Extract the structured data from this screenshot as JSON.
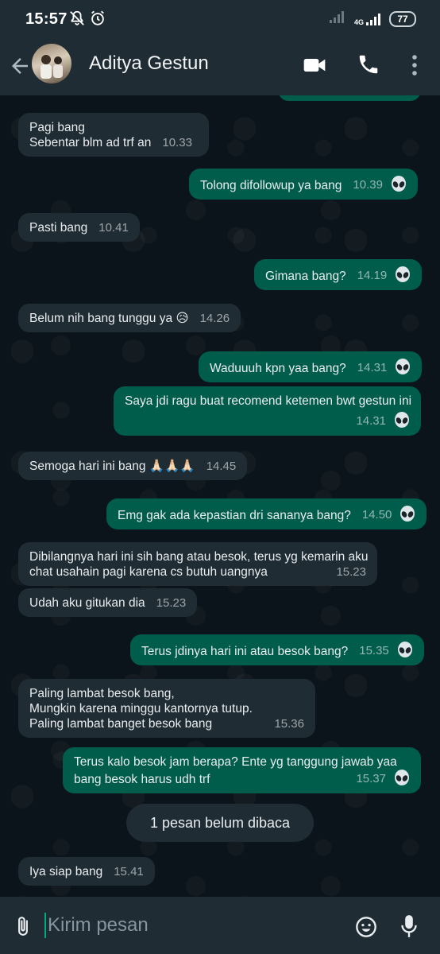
{
  "status_bar": {
    "time": "15:57",
    "network": "4G",
    "battery": "77"
  },
  "header": {
    "contact_name": "Aditya Gestun",
    "back_icon": "arrow-left-icon",
    "video_icon": "video-camera-icon",
    "call_icon": "phone-icon",
    "menu_icon": "more-vert-icon"
  },
  "messages": [
    {
      "direction": "in",
      "lines": [
        "Pagi bang",
        "Sebentar blm ad trf an"
      ],
      "time": "10.33"
    },
    {
      "direction": "out",
      "lines": [
        "Tolong difollowup ya bang"
      ],
      "time": "10.39"
    },
    {
      "direction": "in",
      "lines": [
        "Pasti bang"
      ],
      "time": "10.41"
    },
    {
      "direction": "out",
      "lines": [
        "Gimana bang?"
      ],
      "time": "14.19"
    },
    {
      "direction": "in",
      "lines": [
        "Belum nih bang tunggu ya 😥"
      ],
      "time": "14.26"
    },
    {
      "direction": "out",
      "lines": [
        "Waduuuh kpn yaa bang?"
      ],
      "time": "14.31"
    },
    {
      "direction": "out",
      "lines": [
        "Saya jdi ragu buat recomend ketemen bwt gestun ini"
      ],
      "time": "14.31"
    },
    {
      "direction": "in",
      "lines": [
        "Semoga hari ini bang 🙏🏻🙏🏻🙏🏻"
      ],
      "time": "14.45"
    },
    {
      "direction": "out",
      "lines": [
        "Emg gak ada kepastian dri sananya bang?"
      ],
      "time": "14.50"
    },
    {
      "direction": "in",
      "lines": [
        "Dibilangnya hari ini sih bang atau besok, terus yg kemarin aku",
        "chat usahain pagi karena cs butuh uangnya"
      ],
      "time": "15.23"
    },
    {
      "direction": "in",
      "lines": [
        "Udah aku gitukan dia"
      ],
      "time": "15.23"
    },
    {
      "direction": "out",
      "lines": [
        "Terus jdinya hari ini atau besok bang?"
      ],
      "time": "15.35"
    },
    {
      "direction": "in",
      "lines": [
        "Paling lambat besok bang,",
        "Mungkin karena minggu kantornya tutup.",
        "Paling lambat banget besok bang"
      ],
      "time": "15.36"
    },
    {
      "direction": "out",
      "lines": [
        "Terus kalo besok jam berapa? Ente yg tanggung jawab yaa",
        "bang besok harus udh trf"
      ],
      "time": "15.37"
    },
    {
      "direction": "in",
      "lines": [
        "Iya siap bang"
      ],
      "time": "15.41"
    }
  ],
  "unread_banner": "1 pesan belum dibaca",
  "input": {
    "placeholder": "Kirim pesan",
    "attach_icon": "paperclip-icon",
    "emoji_icon": "emoji-icon",
    "mic_icon": "microphone-icon"
  },
  "colors": {
    "incoming_bubble": "#202c33",
    "outgoing_bubble": "#005c4b",
    "bars": "#1f2c34",
    "background": "#0b141a",
    "accent": "#00a884"
  }
}
